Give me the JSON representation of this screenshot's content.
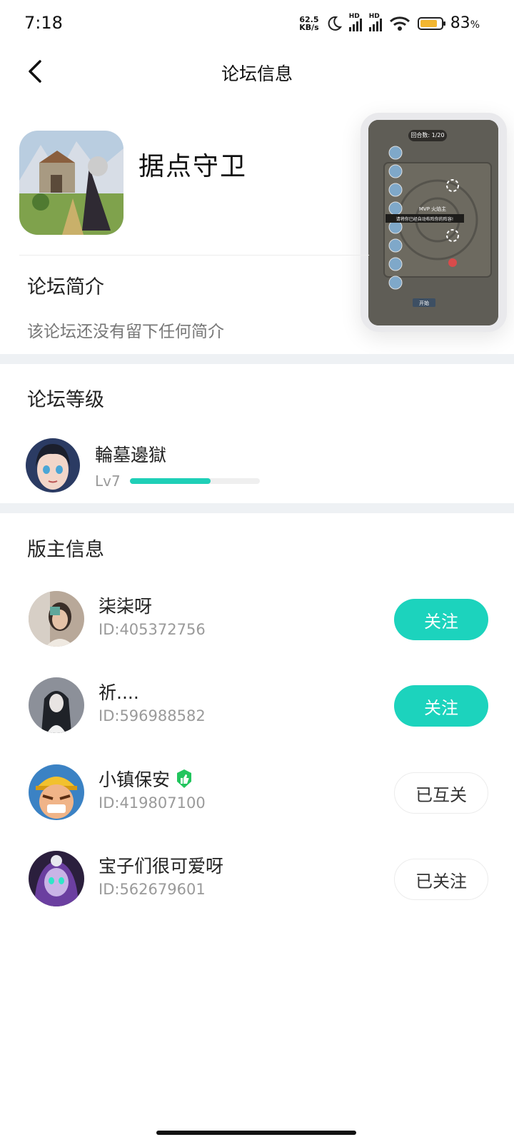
{
  "status_bar": {
    "time": "7:18",
    "net_speed_value": "62.5",
    "net_speed_unit": "KB/s",
    "signal_label": "HD",
    "battery_percent": "83",
    "battery_unit": "%"
  },
  "header": {
    "title": "论坛信息"
  },
  "forum": {
    "name": "据点守卫",
    "intro_title": "论坛简介",
    "intro_text": "该论坛还没有留下任何简介"
  },
  "level": {
    "section_title": "论坛等级",
    "user_name": "輪墓邊獄",
    "level_label": "Lv7",
    "progress": 0.62
  },
  "moderators": {
    "section_title": "版主信息",
    "items": [
      {
        "name": "柒柒呀",
        "id": "ID:405372756",
        "button": "关注"
      },
      {
        "name": "祈....",
        "id": "ID:596988582",
        "button": "关注"
      },
      {
        "name": "小镇保安",
        "id": "ID:419807100",
        "button": "已互关"
      },
      {
        "name": "宝子们很可爱呀",
        "id": "ID:562679601",
        "button": "已关注"
      }
    ]
  },
  "screenshot": {
    "round_label": "回合数: 1/20",
    "mvp_label": "MVP 火焰主",
    "tip": "请将你已经自动布阵你的阵容!",
    "button": "开始"
  },
  "colors": {
    "accent": "#1cd3bd",
    "battery": "#f3b731",
    "badge": "#22c55e"
  }
}
